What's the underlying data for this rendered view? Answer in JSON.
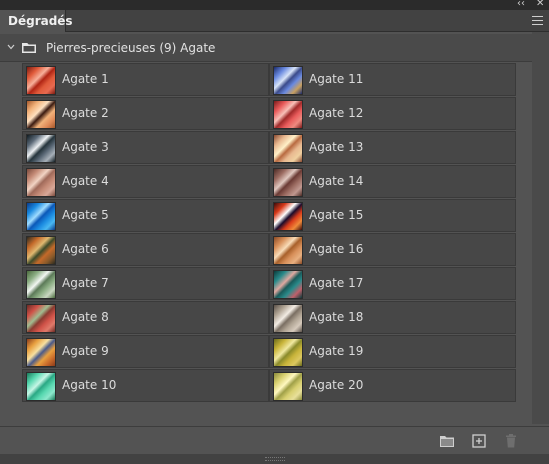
{
  "panel": {
    "tab_title": "Dégradés"
  },
  "group": {
    "title": "Pierres-precieuses (9) Agate"
  },
  "gradients": [
    {
      "label": "Agate 1",
      "stops": [
        "#7a1a10",
        "#e05a3a",
        "#f7b09a",
        "#b02414",
        "#e86a50"
      ]
    },
    {
      "label": "Agate 2",
      "stops": [
        "#a4572a",
        "#f2b27a",
        "#ffe0c0",
        "#3a1a10",
        "#e08a58"
      ]
    },
    {
      "label": "Agate 3",
      "stops": [
        "#0f1a20",
        "#5c6a78",
        "#eef2f4",
        "#25343c",
        "#a7b0b8"
      ]
    },
    {
      "label": "Agate 4",
      "stops": [
        "#7a4a3c",
        "#c48a76",
        "#f1d4c4",
        "#a06a5a",
        "#d8a898"
      ]
    },
    {
      "label": "Agate 5",
      "stops": [
        "#0a3a8a",
        "#1a8ae0",
        "#9fdcff",
        "#0b58b8",
        "#49b8f2"
      ]
    },
    {
      "label": "Agate 6",
      "stops": [
        "#2a2a20",
        "#c46a2a",
        "#e0b870",
        "#3c4a2a",
        "#8a5a2a"
      ]
    },
    {
      "label": "Agate 7",
      "stops": [
        "#4a6a3c",
        "#8cae84",
        "#f2f6f2",
        "#5c7a58",
        "#c8d6c0"
      ]
    },
    {
      "label": "Agate 8",
      "stops": [
        "#6a2a24",
        "#d05248",
        "#a0bc90",
        "#8a3a30",
        "#e07a6a"
      ]
    },
    {
      "label": "Agate 9",
      "stops": [
        "#8a3a1a",
        "#e8a040",
        "#f8e0a0",
        "#4a5a8a",
        "#c86a2a"
      ]
    },
    {
      "label": "Agate 10",
      "stops": [
        "#1a7a5a",
        "#58d8b0",
        "#c6f6e6",
        "#2aa884",
        "#8ce8cc"
      ]
    },
    {
      "label": "Agate 11",
      "stops": [
        "#1a2a6a",
        "#6a8ae0",
        "#d8e4f8",
        "#3a4a8a",
        "#c8a060"
      ]
    },
    {
      "label": "Agate 12",
      "stops": [
        "#7a1a1a",
        "#e85a5a",
        "#f8c0b8",
        "#a02a2a",
        "#f08a80"
      ]
    },
    {
      "label": "Agate 13",
      "stops": [
        "#8a4a30",
        "#e8b890",
        "#fff0c8",
        "#b86a40",
        "#f0d0a0"
      ]
    },
    {
      "label": "Agate 14",
      "stops": [
        "#4a2a24",
        "#9a6a60",
        "#e0c8c0",
        "#6a3a34",
        "#c09890"
      ]
    },
    {
      "label": "Agate 15",
      "stops": [
        "#3a0a0a",
        "#d83a1a",
        "#ffffff",
        "#1a0a2a",
        "#f08a3a"
      ]
    },
    {
      "label": "Agate 16",
      "stops": [
        "#8a4a24",
        "#d8905a",
        "#f8dcb8",
        "#a8602a",
        "#e8b080"
      ]
    },
    {
      "label": "Agate 17",
      "stops": [
        "#0a3a3a",
        "#2a8a8a",
        "#e0a8a0",
        "#1a5a5a",
        "#c0606a"
      ]
    },
    {
      "label": "Agate 18",
      "stops": [
        "#5a5048",
        "#b0a494",
        "#f2ece4",
        "#7a6e62",
        "#d6cabc"
      ]
    },
    {
      "label": "Agate 19",
      "stops": [
        "#6a6a1a",
        "#c8b43a",
        "#f0e8a0",
        "#8a8a2a",
        "#dcc860"
      ]
    },
    {
      "label": "Agate 20",
      "stops": [
        "#8a8a3a",
        "#d8d070",
        "#fff8c0",
        "#a0a048",
        "#e8e09a"
      ]
    }
  ],
  "window_controls": {
    "collapse": "‹‹",
    "close": "✕"
  }
}
